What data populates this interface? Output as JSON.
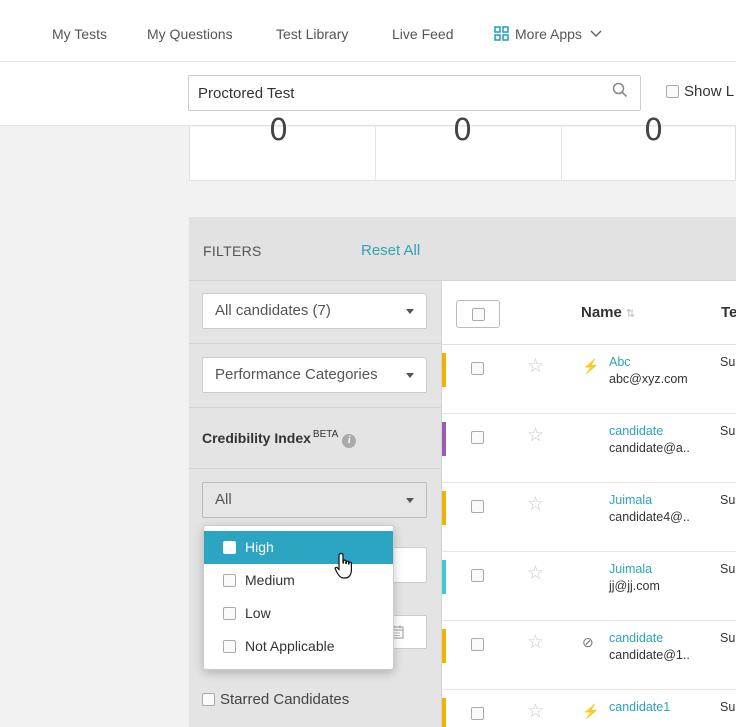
{
  "nav": {
    "items": [
      "My Tests",
      "My Questions",
      "Test Library",
      "Live Feed"
    ],
    "more_apps": "More Apps"
  },
  "search": {
    "value": "Proctored Test",
    "show_label": "Show L"
  },
  "stats": {
    "values": [
      "0",
      "0",
      "0"
    ]
  },
  "filters": {
    "title": "FILTERS",
    "reset": "Reset All",
    "candidates_select": "All candidates (7)",
    "performance_select": "Performance Categories",
    "credibility_label": "Credibility Index",
    "credibility_badge": "BETA",
    "credibility_select": "All",
    "starred": "Starred Candidates"
  },
  "dropdown": {
    "options": [
      "High",
      "Medium",
      "Low",
      "Not Applicable"
    ],
    "highlighted": "High"
  },
  "table": {
    "headers": {
      "name": "Name",
      "te": "Te"
    },
    "rows": [
      {
        "name": "Abc",
        "email": "abc@xyz.com",
        "te": "Su",
        "bar": "#f0b400",
        "icon": "plug-icon"
      },
      {
        "name": "candidate",
        "email": "candidate@a..",
        "te": "Su",
        "bar": "#9c5bb5",
        "icon": ""
      },
      {
        "name": "Juimala",
        "email": "candidate4@..",
        "te": "Su",
        "bar": "#f0b400",
        "icon": ""
      },
      {
        "name": "Juimala",
        "email": "jj@jj.com",
        "te": "Su",
        "bar": "#3fc8d8",
        "icon": ""
      },
      {
        "name": "candidate",
        "email": "candidate@1..",
        "te": "Su",
        "bar": "#f0b400",
        "icon": "blocked-icon"
      },
      {
        "name": "candidate1",
        "email": "",
        "te": "Su",
        "bar": "#f0b400",
        "icon": "plug-icon"
      }
    ]
  },
  "colors": {
    "accent": "#2ba5b7",
    "highlight": "#2ba5c1"
  }
}
